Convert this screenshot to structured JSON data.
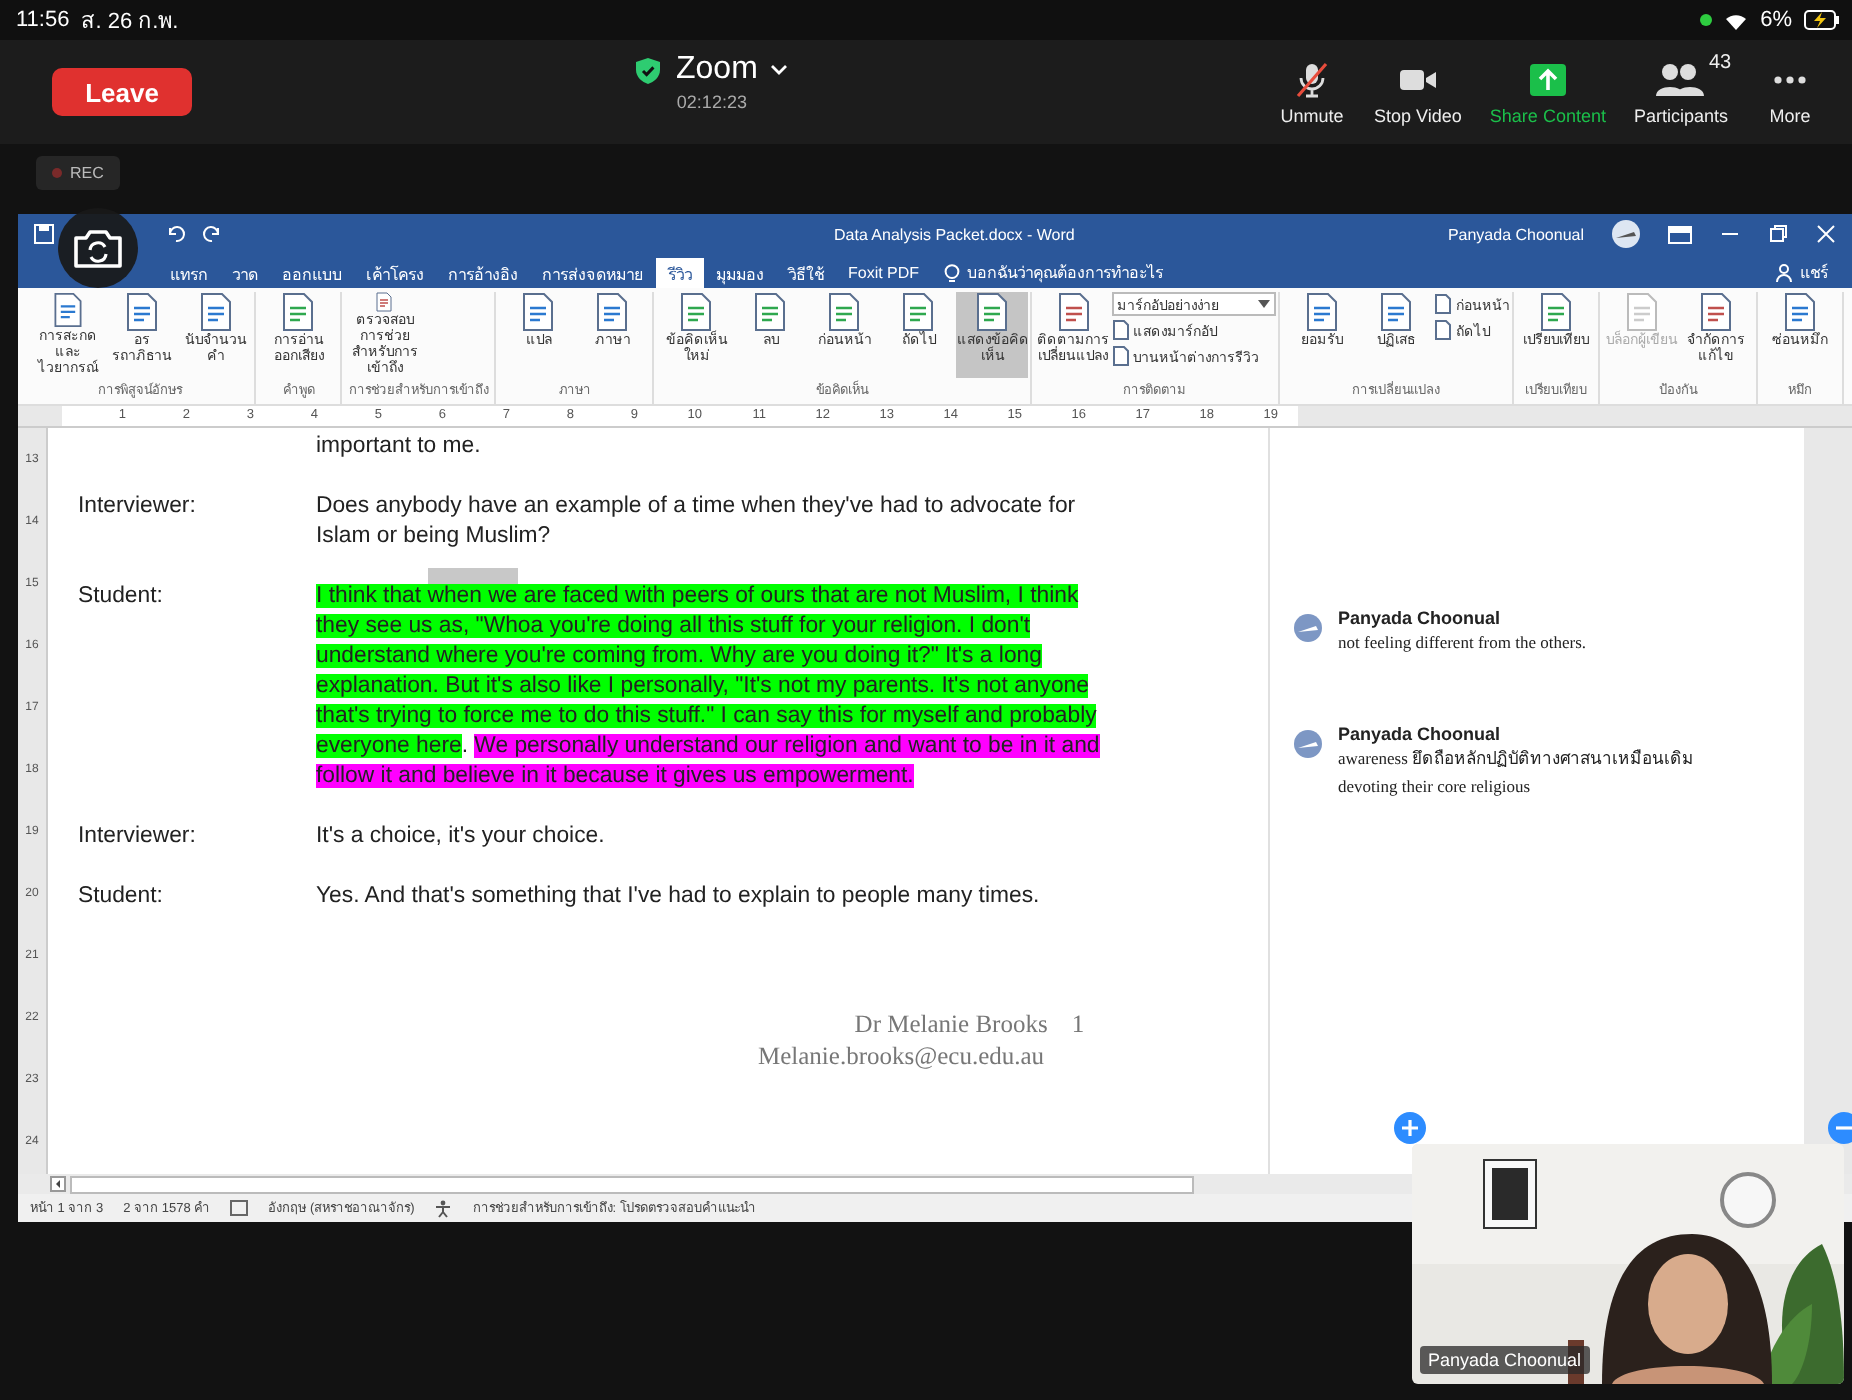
{
  "device_status": {
    "time": "11:56",
    "date": "ส. 26 ก.พ.",
    "battery": "6%"
  },
  "zoom_bar": {
    "leave": "Leave",
    "title": "Zoom",
    "duration": "02:12:23",
    "controls": [
      {
        "kind": "mic",
        "label": "Unmute",
        "muted": true
      },
      {
        "kind": "video",
        "label": "Stop Video"
      },
      {
        "kind": "share",
        "label": "Share Content"
      },
      {
        "kind": "participants",
        "label": "Participants",
        "count": "43"
      },
      {
        "kind": "more",
        "label": "More"
      }
    ]
  },
  "recording": {
    "label": "REC"
  },
  "word": {
    "title": "Data Analysis Packet.docx - Word",
    "user": "Panyada Choonual",
    "tabs": [
      {
        "label": "แทรก",
        "selected": false
      },
      {
        "label": "วาด",
        "selected": false
      },
      {
        "label": "ออกแบบ",
        "selected": false
      },
      {
        "label": "เค้าโครง",
        "selected": false
      },
      {
        "label": "การอ้างอิง",
        "selected": false
      },
      {
        "label": "การส่งจดหมาย",
        "selected": false
      },
      {
        "label": "รีวิว",
        "selected": true
      },
      {
        "label": "มุมมอง",
        "selected": false
      },
      {
        "label": "วิธีใช้",
        "selected": false
      },
      {
        "label": "Foxit PDF",
        "selected": false
      }
    ],
    "tell_me": "บอกฉันว่าคุณต้องการทำอะไร",
    "share": "แชร์",
    "ribbon_groups": [
      {
        "label": "การพิสูจน์อักษร",
        "items": [
          {
            "kind": "large",
            "label": "การสะกดและไวยากรณ์",
            "disabled": false
          },
          {
            "kind": "large",
            "label": "อรรถาภิธาน",
            "disabled": false
          },
          {
            "kind": "large",
            "label": "นับจำนวนคำ",
            "disabled": false
          }
        ]
      },
      {
        "label": "คำพูด",
        "items": [
          {
            "kind": "large",
            "label": "การอ่านออกเสียง",
            "disabled": false
          }
        ]
      },
      {
        "label": "การช่วยสำหรับการเข้าถึง",
        "items": [
          {
            "kind": "large",
            "label": "ตรวจสอบการช่วยสำหรับการเข้าถึง",
            "disabled": false
          }
        ]
      },
      {
        "label": "ภาษา",
        "items": [
          {
            "kind": "large",
            "label": "แปล",
            "disabled": false
          },
          {
            "kind": "large",
            "label": "ภาษา",
            "disabled": false
          }
        ]
      },
      {
        "label": "ข้อคิดเห็น",
        "items": [
          {
            "kind": "large",
            "label": "ข้อคิดเห็นใหม่",
            "disabled": false
          },
          {
            "kind": "large",
            "label": "ลบ",
            "disabled": false
          },
          {
            "kind": "large",
            "label": "ก่อนหน้า",
            "disabled": false
          },
          {
            "kind": "large",
            "label": "ถัดไป",
            "disabled": false
          },
          {
            "kind": "toggle",
            "label": "แสดงข้อคิดเห็น",
            "disabled": false,
            "selected": true
          }
        ]
      },
      {
        "label": "การติดตาม",
        "items": [
          {
            "kind": "large",
            "label": "ติดตามการเปลี่ยนแปลง",
            "disabled": false
          },
          {
            "kind": "dropdown",
            "label": "มาร์กอัปอย่างง่าย",
            "disabled": false
          },
          {
            "kind": "small",
            "label": "แสดงมาร์กอัป",
            "disabled": false
          },
          {
            "kind": "small",
            "label": "บานหน้าต่างการรีวิว",
            "disabled": false
          }
        ]
      },
      {
        "label": "การเปลี่ยนแปลง",
        "items": [
          {
            "kind": "large",
            "label": "ยอมรับ",
            "disabled": false
          },
          {
            "kind": "large",
            "label": "ปฏิเสธ",
            "disabled": false
          },
          {
            "kind": "small",
            "label": "ก่อนหน้า",
            "disabled": false
          },
          {
            "kind": "small",
            "label": "ถัดไป",
            "disabled": false
          }
        ]
      },
      {
        "label": "เปรียบเทียบ",
        "items": [
          {
            "kind": "large",
            "label": "เปรียบเทียบ",
            "disabled": false
          }
        ]
      },
      {
        "label": "ป้องกัน",
        "items": [
          {
            "kind": "large",
            "label": "บล็อกผู้เขียน",
            "disabled": true
          },
          {
            "kind": "large",
            "label": "จำกัดการแก้ไข",
            "disabled": false
          }
        ]
      },
      {
        "label": "หมึก",
        "items": [
          {
            "kind": "large",
            "label": "ซ่อนหมึก",
            "disabled": false
          }
        ]
      }
    ],
    "ruler_numbers": [
      "1",
      "2",
      "3",
      "4",
      "5",
      "6",
      "7",
      "8",
      "9",
      "10",
      "11",
      "12",
      "13",
      "14",
      "15",
      "16",
      "17",
      "18",
      "19"
    ],
    "vertical_ruler_numbers": [
      "13",
      "14",
      "15",
      "16",
      "17",
      "18",
      "19",
      "20",
      "21",
      "22",
      "23",
      "24"
    ],
    "transcript": [
      {
        "segments": [
          {
            "text": "important to me."
          }
        ]
      },
      {
        "speaker": "Interviewer:",
        "segments": [
          {
            "text": "Does anybody have an example of a time when they've had to advocate for Islam or being Muslim?"
          }
        ]
      },
      {
        "speaker": "Student:",
        "segments": [
          {
            "text": "I think that ",
            "color": "#00ff00"
          },
          {
            "text": "when we",
            "color": "#00ff00",
            "selected": true
          },
          {
            "text": " are faced with peers of ours that are not Muslim, I think they see us as, \"Whoa you're doing all this stuff for your religion. I don't understand where you're coming from. Why are you doing it?\" It's a long explanation. But it's also like I personally, \"It's not my parents. It's not anyone that's trying to force me to do this stuff.\" I can say this for myself and probably everyone here",
            "color": "#00ff00"
          },
          {
            "text": ". "
          },
          {
            "text": "We personally understand our religion and want to be in it and follow it and believe in it because it gives us empowerment.",
            "color": "#ff00ff"
          }
        ]
      },
      {
        "speaker": "Interviewer:",
        "segments": [
          {
            "text": "It's a choice, it's your choice."
          }
        ]
      },
      {
        "speaker": "Student:",
        "segments": [
          {
            "text": "Yes. And that's something that I've had to explain to people many times."
          }
        ]
      }
    ],
    "footer": {
      "author": "Dr Melanie Brooks",
      "page": "1",
      "email": "Melanie.brooks@ecu.edu.au"
    },
    "comments": [
      {
        "author": "Panyada Choonual",
        "lines": [
          "not feeling different from  the others."
        ]
      },
      {
        "author": "Panyada Choonual",
        "lines": [
          "awareness ยึดถือหลักปฏิบัติทางศาสนาเหมือนเดิม",
          "devoting their core religious"
        ]
      }
    ],
    "status_bar": [
      "หน้า 1 จาก 3",
      "2 จาก 1578 คำ",
      "อังกฤษ (สหราชอาณาจักร)",
      "การช่วยสำหรับการเข้าถึง: โปรดตรวจสอบคำแนะนำ"
    ]
  },
  "video": {
    "name": "Panyada Choonual"
  }
}
